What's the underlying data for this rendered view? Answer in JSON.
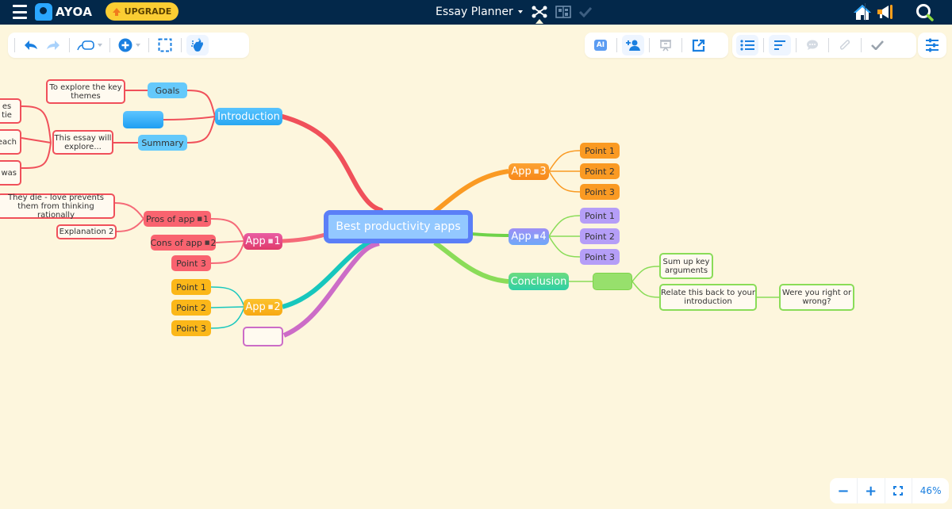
{
  "topbar": {
    "brand": "AYOA",
    "upgrade_label": "UPGRADE",
    "title": "Essay Planner",
    "icons": [
      "menu-icon",
      "ayoa-logo",
      "mind-map-view-icon",
      "board-view-icon",
      "task-view-icon",
      "home-icon",
      "megaphone-icon",
      "search-icon"
    ]
  },
  "toolbar_left": {
    "tools": [
      "undo",
      "redo",
      "branch-style",
      "add",
      "select-area",
      "magic-tidy"
    ]
  },
  "toolbar_right": {
    "ai_label": "AI",
    "tools": [
      "ai",
      "share-user",
      "present",
      "export",
      "outline-view",
      "text-format",
      "comment",
      "attachment",
      "complete"
    ]
  },
  "settings": {
    "icon": "sliders-icon"
  },
  "zoom": {
    "minus": "−",
    "plus": "+",
    "value": "46%"
  },
  "colors": {
    "background": "#fdf6dd",
    "topbar": "#03284a",
    "accent": "#1a7fe0",
    "upgrade": "#fbcd33",
    "intro": "#3bb3f6",
    "intro_branch": "#f0505a",
    "app1": "#e44a85",
    "app1_branch": "#f56a78",
    "app2": "#fbb719",
    "app2_branch": "#17c7bd",
    "app3": "#fa9a23",
    "app4": "#8f8ff5",
    "conclusion": "#3ed19c",
    "green_branch": "#8adc58",
    "purple_branch": "#cc6cc7",
    "center_fill": "#93c8ff",
    "center_border": "#5b7ff7"
  },
  "mindmap": {
    "center": "Best productivity apps",
    "introduction": {
      "label": "Introduction",
      "goals": {
        "label": "Goals",
        "note": "To explore the key themes"
      },
      "blank_label": "",
      "summary": {
        "label": "Summary",
        "note": "This essay will explore...",
        "children": [
          "es tie",
          "each",
          "was"
        ]
      }
    },
    "app1": {
      "label": "App",
      "badge": "1",
      "pros": {
        "label": "Pros of app",
        "badge": "1",
        "notes": [
          "They die - love prevents them from thinking rationally",
          "Explanation 2"
        ]
      },
      "cons": {
        "label": "Cons of app",
        "badge": "2"
      },
      "point3": "Point 3"
    },
    "app2": {
      "label": "App",
      "badge": "2",
      "points": [
        "Point 1",
        "Point 2",
        "Point 3"
      ]
    },
    "empty_branch_label": "",
    "app3": {
      "label": "App",
      "badge": "3",
      "points": [
        "Point 1",
        "Point 2",
        "Point 3"
      ]
    },
    "app4": {
      "label": "App",
      "badge": "4",
      "points": [
        "Point 1",
        "Point 2",
        "Point 3"
      ]
    },
    "conclusion": {
      "label": "Conclusion",
      "blank_label": "",
      "notes": [
        "Sum up key arguments",
        "Relate this back to your introduction"
      ],
      "sub_note": "Were you right or wrong?"
    }
  }
}
